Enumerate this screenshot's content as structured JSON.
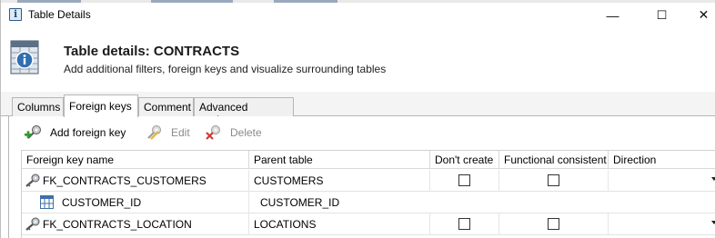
{
  "window": {
    "title": "Table Details",
    "controls": {
      "minimize": "—",
      "maximize": "☐",
      "close": "✕"
    }
  },
  "header": {
    "title": "Table details:  CONTRACTS",
    "subtitle": "Add additional filters, foreign keys and visualize surrounding tables"
  },
  "tabs": [
    {
      "label": "Columns",
      "active": false
    },
    {
      "label": "Foreign keys",
      "active": true
    },
    {
      "label": "Comment",
      "active": false
    },
    {
      "label": "Advanced settings",
      "active": false
    }
  ],
  "toolbar": {
    "add_label": "Add foreign key",
    "edit_label": "Edit",
    "delete_label": "Delete"
  },
  "grid": {
    "columns": [
      "Foreign key name",
      "Parent table",
      "Don't create",
      "Functional consistent",
      "Direction"
    ],
    "rows": [
      {
        "type": "fk",
        "name": "FK_CONTRACTS_CUSTOMERS",
        "parent": "CUSTOMERS",
        "dont_create": false,
        "functional": false,
        "direction": ""
      },
      {
        "type": "column",
        "name": "CUSTOMER_ID",
        "parent": "CUSTOMER_ID"
      },
      {
        "type": "fk",
        "name": "FK_CONTRACTS_LOCATION",
        "parent": "LOCATIONS",
        "dont_create": false,
        "functional": false,
        "direction": ""
      }
    ]
  },
  "colors": {
    "accent_blue": "#2c5c8c",
    "grid_line": "#d9d9d9",
    "disabled_text": "#8a8a8a"
  }
}
